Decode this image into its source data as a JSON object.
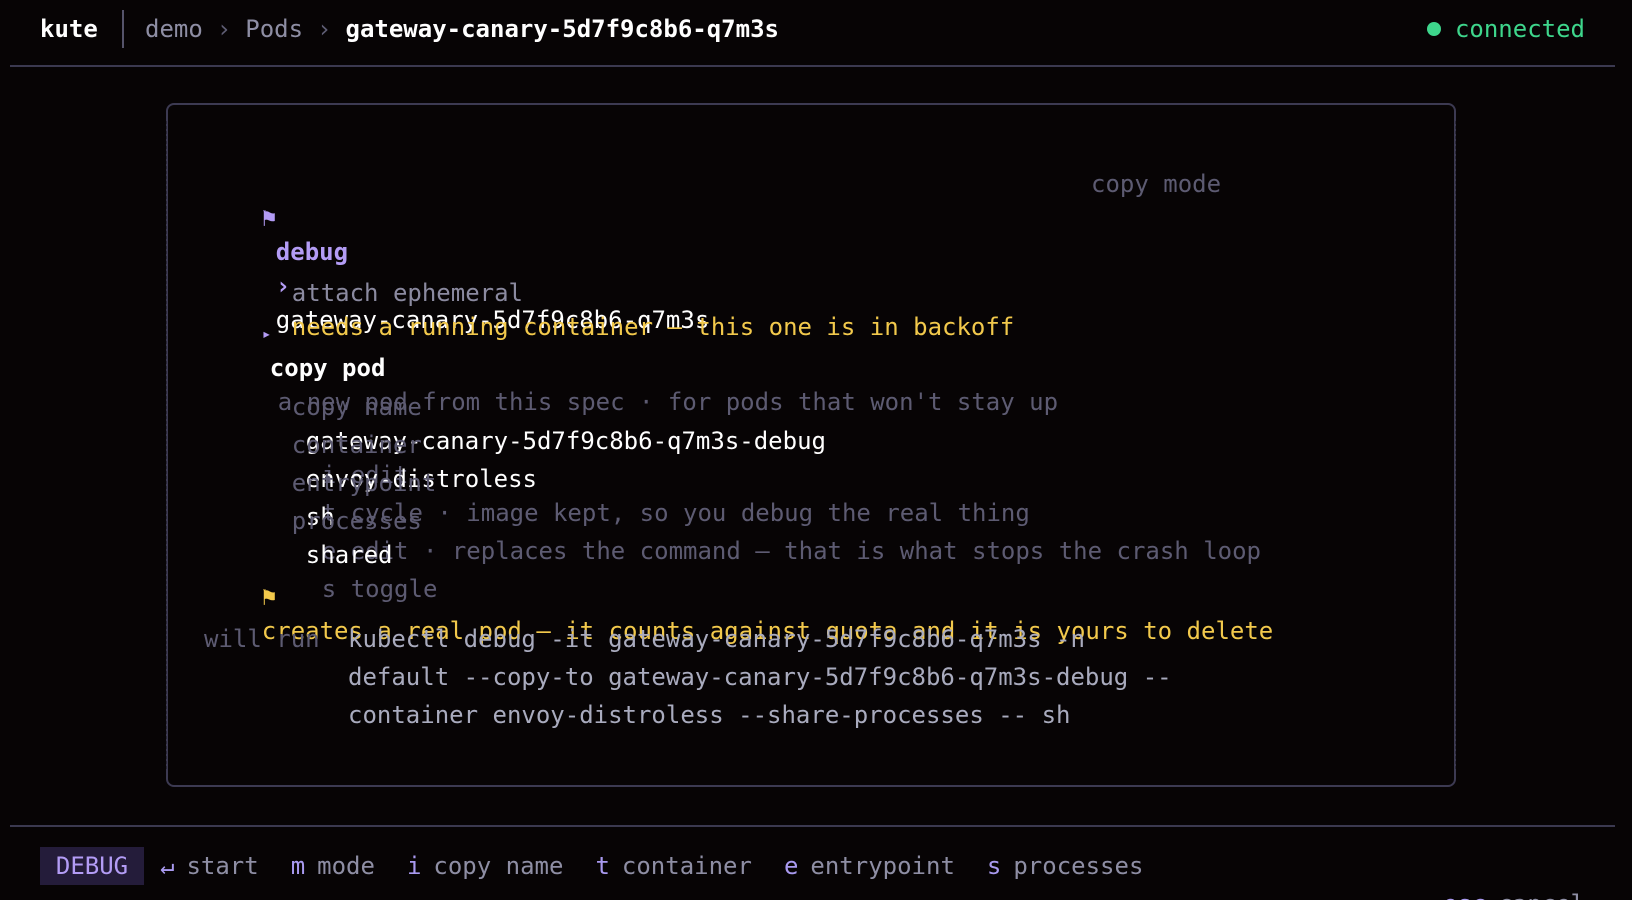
{
  "header": {
    "app_name": "kute",
    "breadcrumb": [
      "demo",
      "Pods",
      "gateway-canary-5d7f9c8b6-q7m3s"
    ],
    "status": "connected"
  },
  "dialog": {
    "title_icon": "flag-icon",
    "title_label": "debug",
    "title_arrow": "›",
    "title_target": "gateway-canary-5d7f9c8b6-q7m3s",
    "mode_label": "copy mode",
    "options": [
      {
        "label": "attach ephemeral",
        "note": "needs a running container — this one is in backoff",
        "selected": false
      },
      {
        "label": "copy pod",
        "note": "a new pod from this spec · for pods that won't stay up",
        "selected": true
      }
    ],
    "fields": [
      {
        "label": "copy name",
        "value": "gateway-canary-5d7f9c8b6-q7m3s-debug",
        "hint": "i edit"
      },
      {
        "label": "container",
        "value": "envoy-distroless",
        "hint": "t cycle · image kept, so you debug the real thing"
      },
      {
        "label": "entrypoint",
        "value": "sh",
        "hint": "e edit · replaces the command — that is what stops the crash loop"
      },
      {
        "label": "processes",
        "value": "shared",
        "hint": "s toggle"
      }
    ],
    "warning": "creates a real pod — it counts against quota and it is yours to delete",
    "will_run_label": "will run",
    "command_lines": [
      "kubectl debug -it gateway-canary-5d7f9c8b6-q7m3s -n",
      "default --copy-to gateway-canary-5d7f9c8b6-q7m3s-debug --",
      "container envoy-distroless --share-processes -- sh"
    ]
  },
  "footer": {
    "mode": "DEBUG",
    "hints": [
      {
        "key": "↵",
        "label": "start"
      },
      {
        "key": "m",
        "label": "mode"
      },
      {
        "key": "i",
        "label": "copy name"
      },
      {
        "key": "t",
        "label": "container"
      },
      {
        "key": "e",
        "label": "entrypoint"
      },
      {
        "key": "s",
        "label": "processes"
      }
    ],
    "cancel": {
      "key": "esc",
      "label": "cancel"
    }
  },
  "colors": {
    "accent": "#b39cf5",
    "warning": "#f2c94c",
    "connected": "#3ed68c",
    "background": "#070405"
  }
}
